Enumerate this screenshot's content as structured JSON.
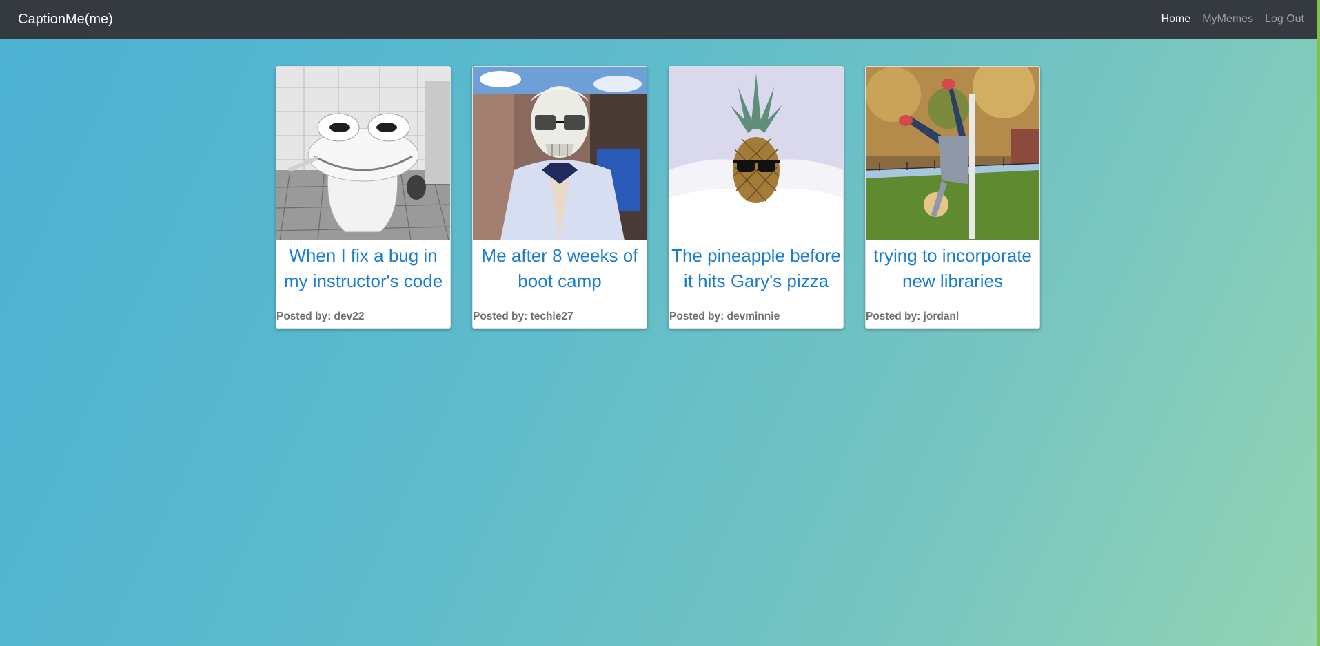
{
  "navbar": {
    "brand": "CaptionMe(me)",
    "links": [
      {
        "label": "Home",
        "active": true
      },
      {
        "label": "MyMemes",
        "active": false
      },
      {
        "label": "Log Out",
        "active": false
      }
    ]
  },
  "colors": {
    "navbar_bg": "#343a40",
    "caption_blue": "#1a7ccf",
    "gradient_start": "#4db1d3",
    "gradient_end": "#94d4b3"
  },
  "memes": [
    {
      "caption": "When I fix a bug in my instructor's code",
      "posted_by": "Posted by: dev22",
      "image": "toilet-frog-face-photo"
    },
    {
      "caption": "Me after 8 weeks of boot camp",
      "posted_by": "Posted by: techie27",
      "image": "skeleton-with-glasses-photo"
    },
    {
      "caption": "The pineapple before it hits Gary's pizza",
      "posted_by": "Posted by: devminnie",
      "image": "pineapple-with-sunglasses-photo"
    },
    {
      "caption": "trying to incorporate new libraries",
      "posted_by": "Posted by: jordanl",
      "image": "kid-handstand-in-park-photo"
    }
  ]
}
